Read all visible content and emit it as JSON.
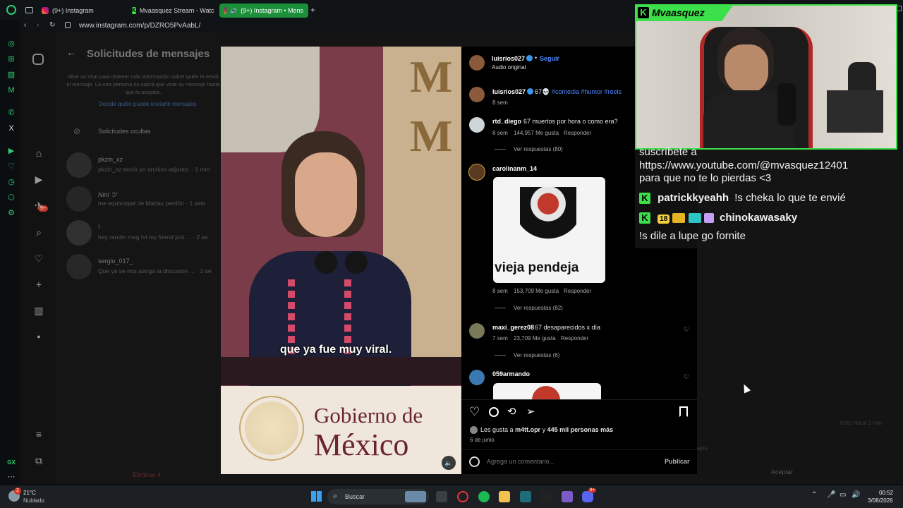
{
  "browser": {
    "tabs": [
      {
        "label": "(9+) Instagram"
      },
      {
        "label": "Mvaasquez Stream - Watc"
      },
      {
        "label": "(9+) Instagram • Mens"
      }
    ],
    "url": "www.instagram.com/p/DZRO5PvAabL/"
  },
  "messages": {
    "title": "Solicitudes de mensajes",
    "info": "Abre un chat para obtener más información sobre quién te envió el mensaje. La otra persona no sabrá que viste su mensaje hasta que lo aceptes.",
    "decide_link": "Decide quién puede enviarte mensajes",
    "hidden_label": "Solicitudes ocultas",
    "items": [
      {
        "name": "pkzin_xz",
        "preview": "pkzin_xz envió un archivo adjunto. · 1 min"
      },
      {
        "name": "Nini ツ",
        "preview": "me equivoqué de Matías perdón · 1 sem"
      },
      {
        "name": "!",
        "preview": "hey randm msg lol my friend just ... · 2 se"
      },
      {
        "name": "sergio_017_",
        "preview": "Que ya se nos alarga la discusión ... · 2 se"
      }
    ],
    "badge": "9+",
    "delete_label": "Eliminar 4",
    "accept_label": "Aceptar",
    "seen_label": "Visto Hace 1 min",
    "sent_label": "ajes."
  },
  "video": {
    "subtitle": "que ya fue muy viral.",
    "banner_line1": "Gobierno de",
    "banner_line2": "México",
    "bg_letter_1": "M",
    "bg_letter_2": "M"
  },
  "post": {
    "author": "luisrios027",
    "follow": "Seguir",
    "audio": "Audio original",
    "caption_text": "67💀",
    "caption_tags": "#comedia #humor #reels",
    "caption_time": "8 sem",
    "comments": [
      {
        "user": "rtd_diego",
        "text": "67 muertos por hora o como era?",
        "time": "8 sem",
        "likes": "144,957 Me gusta",
        "reply": "Responder",
        "replies": "Ver respuestas (80)"
      },
      {
        "user": "carolinanm_14",
        "text": "",
        "sticker_text": "vieja pendeja",
        "time": "8 sem",
        "likes": "153,709 Me gusta",
        "reply": "Responder",
        "replies": "Ver respuestas (82)"
      },
      {
        "user": "maxi_gerez08",
        "text": "67 desaparecidos x día",
        "time": "7 sem",
        "likes": "23,709 Me gusta",
        "reply": "Responder",
        "replies": "Ver respuestas (6)"
      },
      {
        "user": "059armando",
        "text": ""
      }
    ],
    "likes_prefix": "Les gusta a",
    "likes_user": "m4tt.opr",
    "likes_mid": "y",
    "likes_count": "445 mil personas más",
    "date": "6 de junio",
    "comment_placeholder": "Agrega un comentario...",
    "publish": "Publicar"
  },
  "stream": {
    "streamer": "Mvaasquez",
    "chat": [
      {
        "user": "",
        "text": "suscríbete a"
      },
      {
        "user": "",
        "text": "https://www.youtube.com/@mvasquez12401"
      },
      {
        "user": "",
        "text": "para que no te lo pierdas <3"
      },
      {
        "user": "patrickkyeahh",
        "text": "!s cheka lo que te envié"
      },
      {
        "user": "chinokawasaky",
        "text": "!s dile a lupe go fornite",
        "badge": "18"
      }
    ]
  },
  "taskbar": {
    "temp": "21°C",
    "weather": "Nublado",
    "weather_badge": "2",
    "search": "Buscar",
    "time": "00:52",
    "date": "3/08/2026",
    "discord_badge": "9+"
  },
  "colors": {
    "opera_green": "#2ecc71",
    "kick_green": "#3ce04a",
    "link_blue": "#4f86ff"
  }
}
